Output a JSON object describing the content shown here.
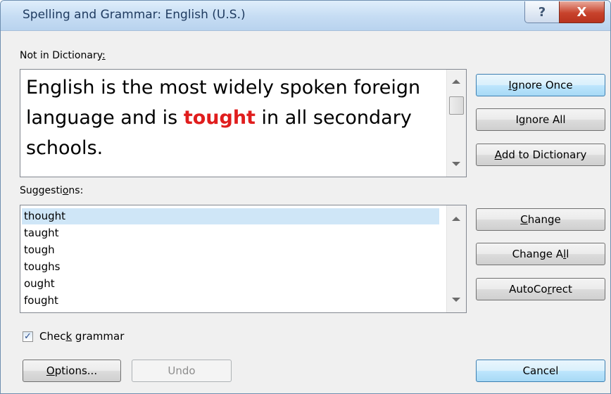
{
  "window": {
    "title": "Spelling and Grammar: English (U.S.)",
    "help_glyph": "?",
    "close_glyph": "X"
  },
  "not_in_dictionary": {
    "label_pre": "Not in Dictionary",
    "label_key": ":",
    "text_before": "English is the most widely spoken foreign language and is ",
    "error_word": "tought",
    "text_after": " in all secondary schools.",
    "error_color": "#e01d1d"
  },
  "suggestions": {
    "label_pre": "Suggesti",
    "label_key": "o",
    "label_post": "ns:",
    "items": [
      "thought",
      "taught",
      "tough",
      "toughs",
      "ought",
      "fought"
    ],
    "selected_index": 0
  },
  "buttons": {
    "ignore_once": {
      "pre": "",
      "key": "I",
      "post": "gnore Once"
    },
    "ignore_all": {
      "pre": "I",
      "key": "g",
      "post": "nore All"
    },
    "add_to_dictionary": {
      "pre": "",
      "key": "A",
      "post": "dd to Dictionary"
    },
    "change": {
      "pre": "",
      "key": "C",
      "post": "hange"
    },
    "change_all": {
      "pre": "Change A",
      "key": "l",
      "post": "l"
    },
    "autocorrect": {
      "pre": "AutoCo",
      "key": "r",
      "post": "rect"
    },
    "options": {
      "pre": "",
      "key": "O",
      "post": "ptions..."
    },
    "undo": "Undo",
    "cancel": "Cancel"
  },
  "check_grammar": {
    "pre": "Chec",
    "key": "k",
    "post": " grammar",
    "checked": true,
    "check_glyph": "✓"
  }
}
